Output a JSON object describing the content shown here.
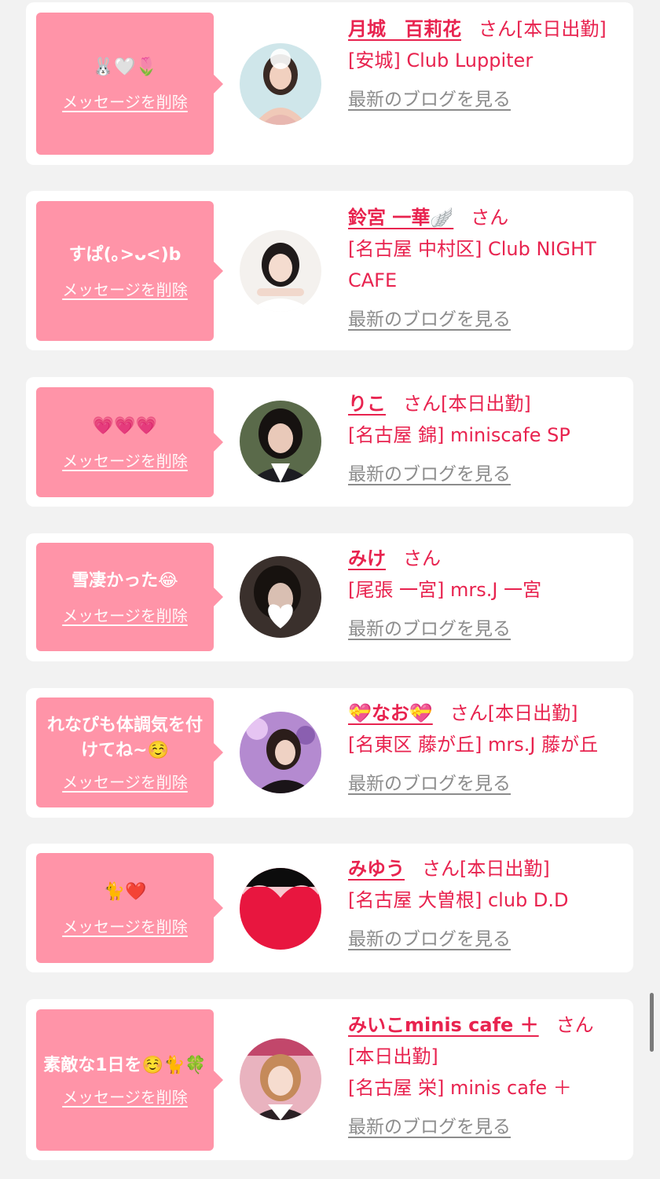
{
  "colors": {
    "accent": "#e8234f",
    "bubble": "#ff94a8",
    "link_gray": "#8c8c8c",
    "background": "#f2f2f2"
  },
  "labels": {
    "delete": "メッセージを削除",
    "blog": "最新のブログを見る",
    "san": "さん"
  },
  "entries": [
    {
      "message": "🐰🤍🌷",
      "name": "月城　百莉花",
      "status": "[本日出勤]",
      "shop": "[安城] Club Luppiter"
    },
    {
      "message": "すぱ(｡>ᴗ<)b",
      "name": "鈴宮 一華🪽",
      "status": "",
      "shop": "[名古屋 中村区] Club NIGHT CAFE"
    },
    {
      "message": "💗💗💗",
      "name": "りこ",
      "status": "[本日出勤]",
      "shop": "[名古屋 錦] miniscafe SP"
    },
    {
      "message": "雪凄かった😂",
      "name": "みけ",
      "status": "",
      "shop": "[尾張 一宮] mrs.J 一宮"
    },
    {
      "message": "れなぴも体調気を付けてね~☺️",
      "name": "💝なお💝",
      "status": "[本日出勤]",
      "shop": "[名東区 藤が丘] mrs.J 藤が丘"
    },
    {
      "message": "🐈❤️",
      "name": "みゆう",
      "status": "[本日出勤]",
      "shop": "[名古屋 大曽根] club D.D"
    },
    {
      "message": "素敵な1日を☺️🐈🍀",
      "name": "みいこminis cafe ＋",
      "status": "[本日出勤]",
      "shop": "[名古屋 栄] minis cafe ＋"
    }
  ]
}
